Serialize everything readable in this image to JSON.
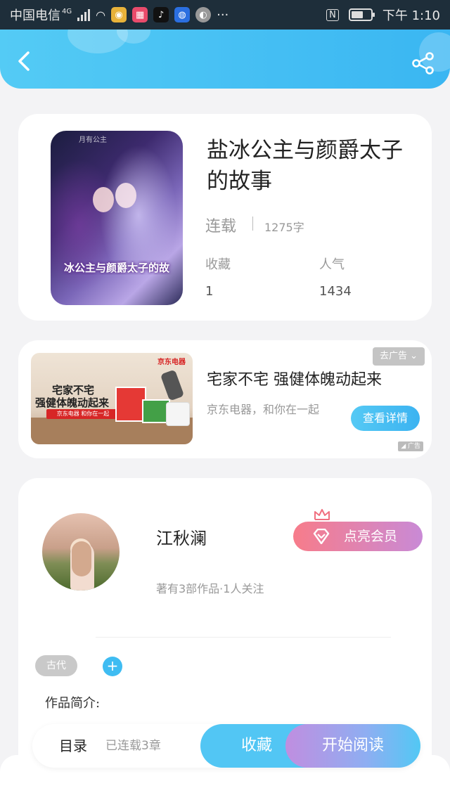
{
  "status_bar": {
    "carrier": "中国电信",
    "network": "4G",
    "more": "···",
    "time": "下午 1:10",
    "battery_level": 0.6,
    "nfc": "N"
  },
  "header": {
    "back_icon": "chevron-left-icon",
    "share_icon": "share-icon"
  },
  "book": {
    "cover_text": "冰公主与颜爵太子的故",
    "cover_mark": "月有公主",
    "title": "盐冰公主与颜爵太子的故事",
    "status": "连载",
    "word_count": "1275字",
    "stats": [
      {
        "label": "收藏",
        "value": "1"
      },
      {
        "label": "人气",
        "value": "1434"
      }
    ]
  },
  "ad": {
    "close_label": "去广告",
    "image_line1": "宅家不宅",
    "image_line2": "强健体魄动起来",
    "image_bar": "京东电器  和你在一起",
    "image_brand": "京东电器",
    "title": "宅家不宅 强健体魄动起来",
    "description": "京东电器，和你在一起",
    "detail_button": "查看详情",
    "tag": "广告"
  },
  "author": {
    "name": "江秋澜",
    "vip_button": "点亮会员",
    "info": "著有3部作品·1人关注",
    "tags": [
      "古代"
    ],
    "add_tag": "+",
    "intro_label": "作品简介:"
  },
  "bottom_bar": {
    "toc_label": "目录",
    "chapter_info": "已连载3章",
    "favorite_button": "收藏",
    "read_button": "开始阅读"
  },
  "colors": {
    "header_blue": "#3ab6f2",
    "accent_blue": "#52c6f4",
    "vip_pink": "#f77c8a",
    "vip_purple": "#c98ad6"
  }
}
